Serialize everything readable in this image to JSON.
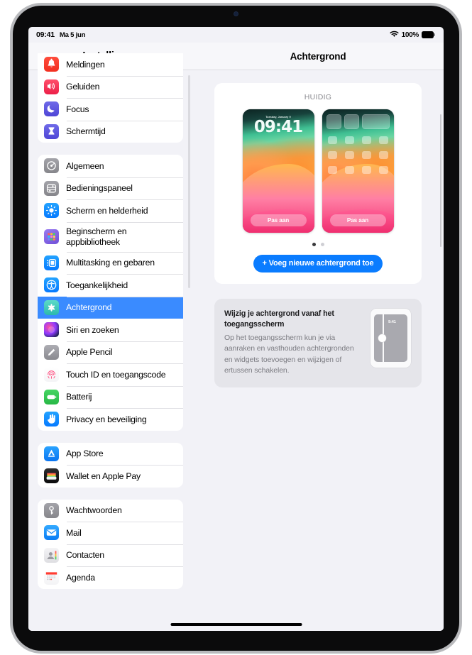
{
  "statusbar": {
    "time": "09:41",
    "date": "Ma 5 jun",
    "wifi_icon": "wifi-icon",
    "battery_percent": "100%",
    "battery_icon": "battery-full-icon"
  },
  "sidebar": {
    "title": "Instellingen",
    "groups": [
      {
        "items": [
          {
            "label": "Meldingen",
            "icon": "bell-icon"
          },
          {
            "label": "Geluiden",
            "icon": "speaker-icon"
          },
          {
            "label": "Focus",
            "icon": "moon-icon"
          },
          {
            "label": "Schermtijd",
            "icon": "hourglass-icon"
          }
        ]
      },
      {
        "items": [
          {
            "label": "Algemeen",
            "icon": "gear-icon"
          },
          {
            "label": "Bedieningspaneel",
            "icon": "sliders-icon"
          },
          {
            "label": "Scherm en helderheid",
            "icon": "brightness-icon"
          },
          {
            "label": "Beginscherm en appbibliotheek",
            "icon": "app-grid-icon"
          },
          {
            "label": "Multitasking en gebaren",
            "icon": "multitask-icon"
          },
          {
            "label": "Toegankelijkheid",
            "icon": "accessibility-icon"
          },
          {
            "label": "Achtergrond",
            "icon": "wallpaper-icon",
            "selected": true
          },
          {
            "label": "Siri en zoeken",
            "icon": "siri-icon"
          },
          {
            "label": "Apple Pencil",
            "icon": "pencil-icon"
          },
          {
            "label": "Touch ID en toegangscode",
            "icon": "fingerprint-icon"
          },
          {
            "label": "Batterij",
            "icon": "battery-icon"
          },
          {
            "label": "Privacy en beveiliging",
            "icon": "hand-icon"
          }
        ]
      },
      {
        "items": [
          {
            "label": "App Store",
            "icon": "appstore-icon"
          },
          {
            "label": "Wallet en Apple Pay",
            "icon": "wallet-icon"
          }
        ]
      },
      {
        "items": [
          {
            "label": "Wachtwoorden",
            "icon": "key-icon"
          },
          {
            "label": "Mail",
            "icon": "mail-icon"
          },
          {
            "label": "Contacten",
            "icon": "contacts-icon"
          },
          {
            "label": "Agenda",
            "icon": "calendar-icon"
          }
        ]
      }
    ]
  },
  "detail": {
    "title": "Achtergrond",
    "current_caption": "HUIDIG",
    "previews": {
      "lock": {
        "name": "lock-screen-preview",
        "date": "Tuesday, January 9",
        "time": "09:41",
        "customize_label": "Pas aan"
      },
      "home": {
        "name": "home-screen-preview",
        "customize_label": "Pas aan"
      }
    },
    "page_dots": {
      "count": 2,
      "active_index": 0
    },
    "add_button_label": "+ Voeg nieuwe achtergrond toe",
    "info": {
      "title": "Wijzig je achtergrond vanaf het toegangsscherm",
      "body": "Op het toegangsscherm kun je via aanraken en vasthouden achtergronden en widgets toevoegen en wijzigen of ertussen schakelen.",
      "illustration_time": "9:41"
    }
  },
  "colors": {
    "accent_blue": "#0a7cff",
    "selected_row": "#3a8bff",
    "pane_background": "#f2f2f7",
    "card_background": "#ffffff",
    "info_card_background": "#e5e5ea"
  }
}
